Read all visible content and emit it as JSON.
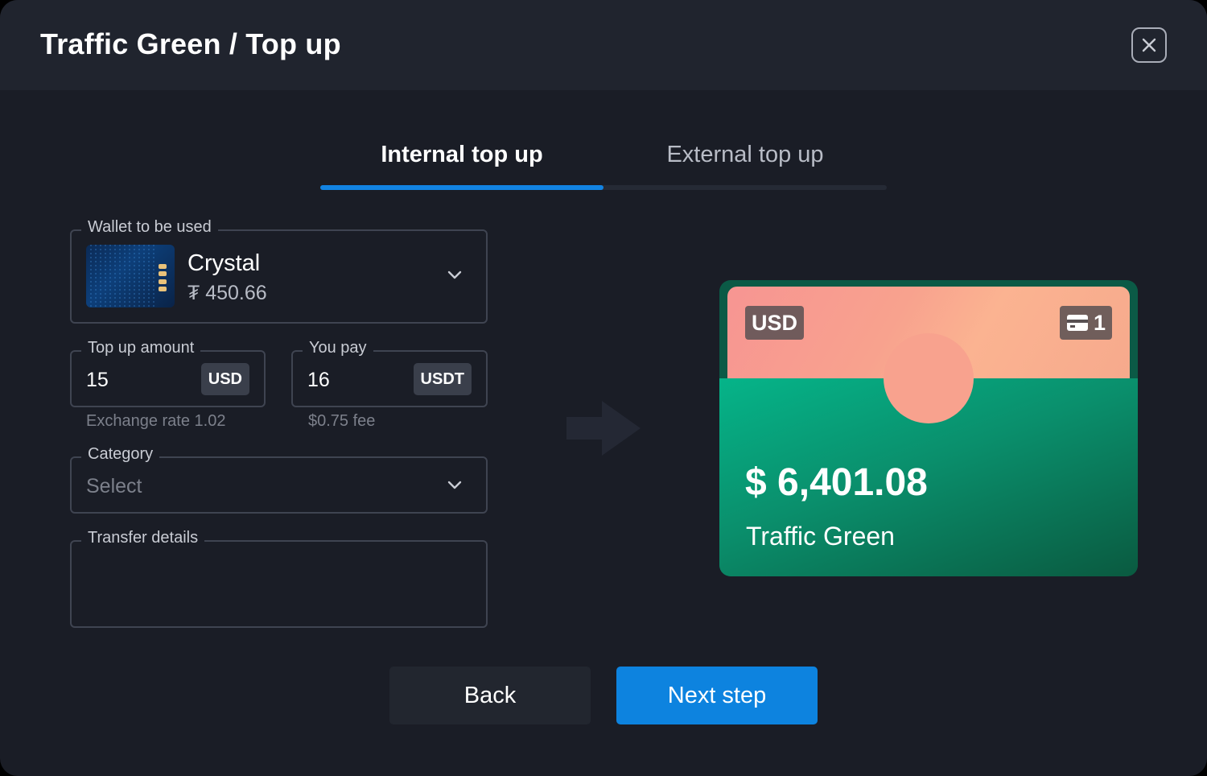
{
  "header": {
    "title": "Traffic Green / Top up"
  },
  "tabs": [
    {
      "label": "Internal top up",
      "active": true
    },
    {
      "label": "External top up",
      "active": false
    }
  ],
  "wallet": {
    "label": "Wallet to be used",
    "name": "Crystal",
    "balance": "₮ 450.66"
  },
  "top_up_amount": {
    "label": "Top up amount",
    "value": "15",
    "currency": "USD",
    "helper": "Exchange rate 1.02"
  },
  "you_pay": {
    "label": "You pay",
    "value": "16",
    "currency": "USDT",
    "helper": "$0.75 fee"
  },
  "category": {
    "label": "Category",
    "placeholder": "Select"
  },
  "transfer_details": {
    "label": "Transfer details",
    "value": ""
  },
  "card": {
    "currency": "USD",
    "card_count": "1",
    "balance": "$ 6,401.08",
    "name": "Traffic Green"
  },
  "actions": {
    "back_label": "Back",
    "next_label": "Next step"
  },
  "colors": {
    "accent": "#0d83df",
    "background": "#1a1d26",
    "header": "#20242e",
    "card_green": "#05b489",
    "card_pink": "#f8a28e"
  },
  "icons": [
    "close-icon",
    "chevron-down-icon",
    "arrow-right-icon",
    "card-icon"
  ]
}
